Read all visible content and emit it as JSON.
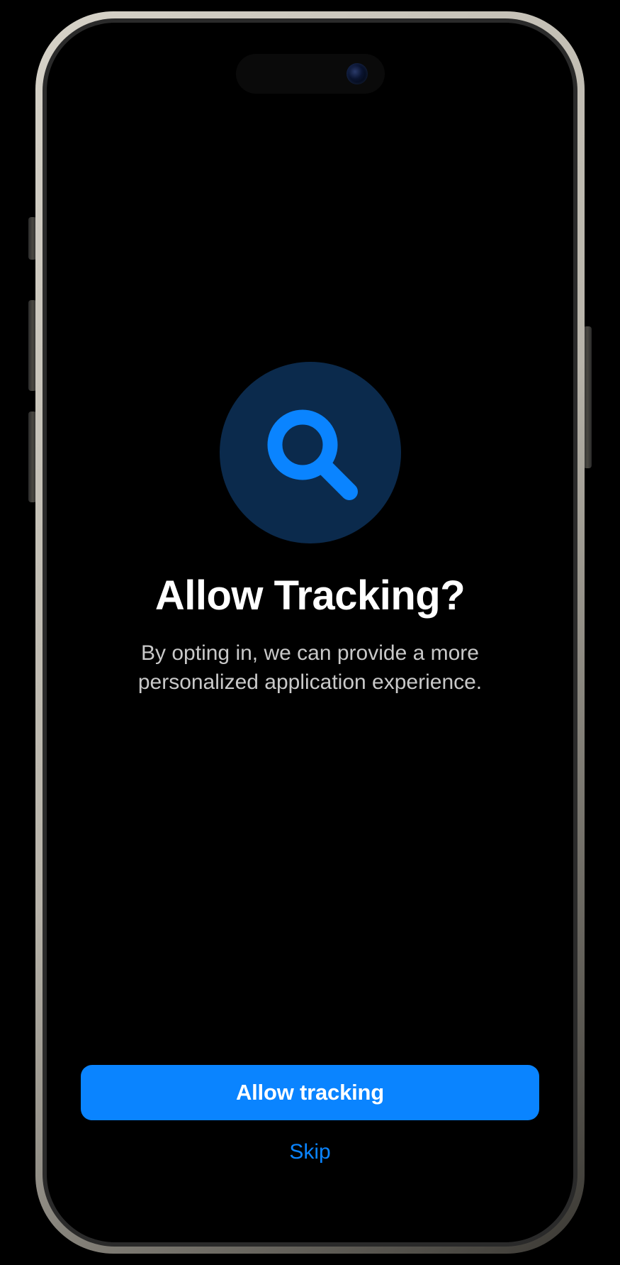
{
  "tracking_prompt": {
    "title": "Allow Tracking?",
    "subtitle": "By opting in, we can provide a more personalized application experience.",
    "primary_button_label": "Allow tracking",
    "secondary_button_label": "Skip",
    "icon": "search-icon"
  },
  "colors": {
    "accent": "#0a84ff",
    "icon_circle_bg": "#0b2a4c",
    "screen_bg": "#000000",
    "title_text": "#ffffff",
    "subtitle_text": "#c9c9c9"
  }
}
